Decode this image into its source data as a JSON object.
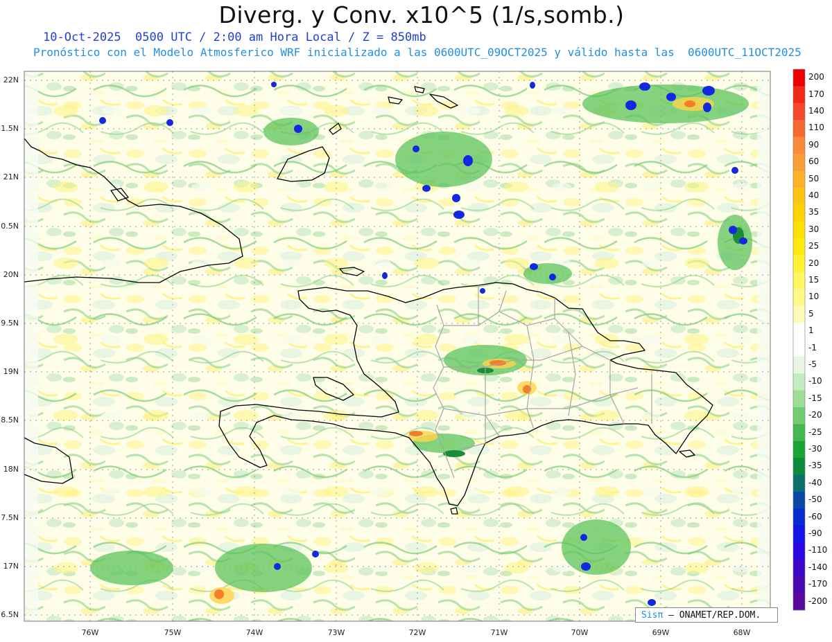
{
  "title": "Diverg. y Conv. x10^5 (1/s,somb.)",
  "subtitle_date": "10-Oct-2025  0500 UTC / 2:00 am Hora Local / Z = 850mb",
  "subtitle_model": "Pronóstico con el Modelo Atmosferico WRF inicializado a las 0600UTC_09OCT2025 y válido hasta las  0600UTC_11OCT2025",
  "credit": {
    "logo": "Sisπ",
    "text": "– ONAMET/REP.DOM."
  },
  "lat_labels": [
    "22N",
    "1.5N",
    "21N",
    "0.5N",
    "20N",
    "9.5N",
    "19N",
    "8.5N",
    "18N",
    "7.5N",
    "17N",
    "6.5N"
  ],
  "lon_labels": [
    "76W",
    "75W",
    "74W",
    "73W",
    "72W",
    "71W",
    "70W",
    "69W",
    "68W"
  ],
  "colorbar": {
    "labels": [
      "200",
      "170",
      "140",
      "110",
      "90",
      "60",
      "50",
      "40",
      "35",
      "30",
      "25",
      "20",
      "15",
      "10",
      "5",
      "1",
      "-1",
      "-5",
      "-10",
      "-15",
      "-20",
      "-25",
      "-30",
      "-35",
      "-40",
      "-50",
      "-60",
      "-90",
      "-110",
      "-140",
      "-170",
      "-200"
    ],
    "colors": [
      "#ee0000",
      "#f02a1a",
      "#f24a2a",
      "#f56a30",
      "#f88a3a",
      "#fa9d38",
      "#fcb128",
      "#fdc414",
      "#fed400",
      "#ffe000",
      "#ffea10",
      "#fff232",
      "#fff660",
      "#fff98c",
      "#fffbb8",
      "#ffffff",
      "#ffffff",
      "#eaf6e4",
      "#c5ecc0",
      "#9edd98",
      "#72cc70",
      "#46b850",
      "#19a436",
      "#0a8c3c",
      "#0e6e6c",
      "#0a4aa6",
      "#0a2ad2",
      "#1414e6",
      "#2a08e2",
      "#3c06c8",
      "#4c08b0",
      "#58089a"
    ]
  }
}
